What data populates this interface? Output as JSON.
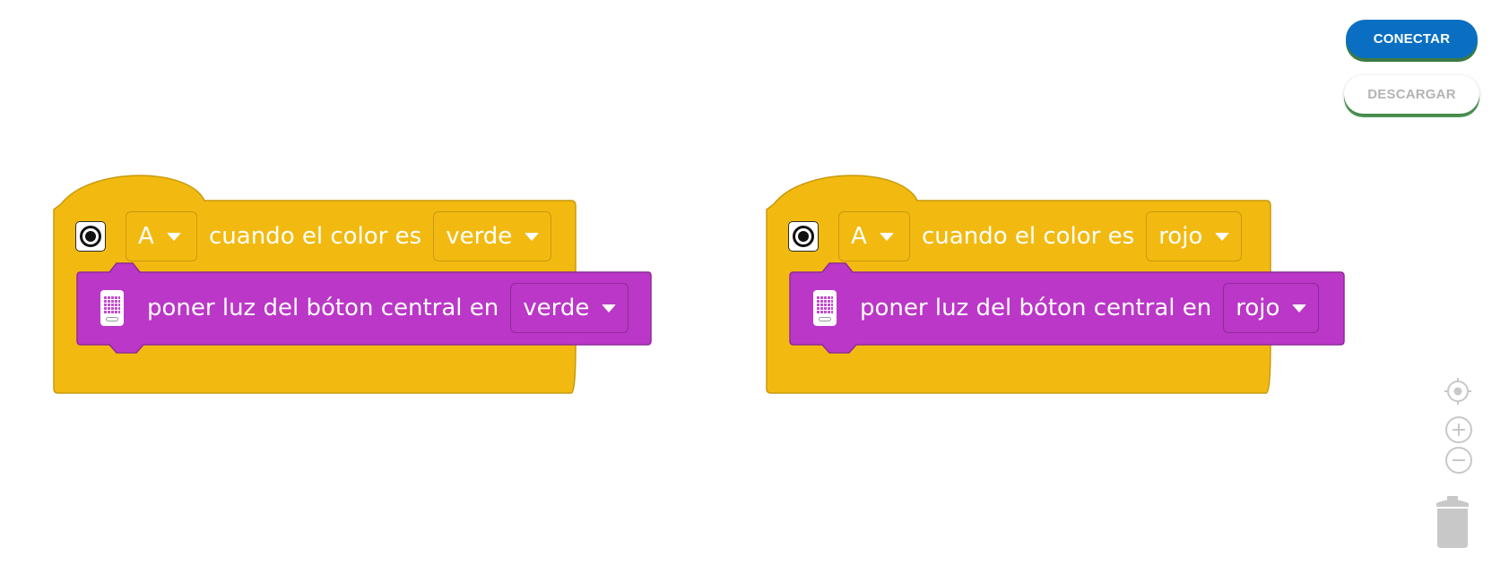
{
  "toolbar": {
    "connect_label": "CONECTAR",
    "download_label": "DESCARGAR"
  },
  "colors": {
    "event_block": "#f2ba10",
    "action_block": "#bb37c8",
    "connect_button": "#0a6fc2",
    "button_underline": "#4e9a55"
  },
  "blocks": [
    {
      "event": {
        "icon": "color-sensor-icon",
        "port": "A",
        "text": "cuando el color es",
        "color_value": "verde"
      },
      "action": {
        "icon": "hub-icon",
        "text": "poner luz del bóton central en",
        "color_value": "verde"
      }
    },
    {
      "event": {
        "icon": "color-sensor-icon",
        "port": "A",
        "text": "cuando el color es",
        "color_value": "rojo"
      },
      "action": {
        "icon": "hub-icon",
        "text": "poner luz del bóton central en",
        "color_value": "rojo"
      }
    }
  ],
  "controls": {
    "recenter": "crosshair-icon",
    "zoom_in": "zoom-in-icon",
    "zoom_out": "zoom-out-icon",
    "trash": "trash-icon"
  }
}
